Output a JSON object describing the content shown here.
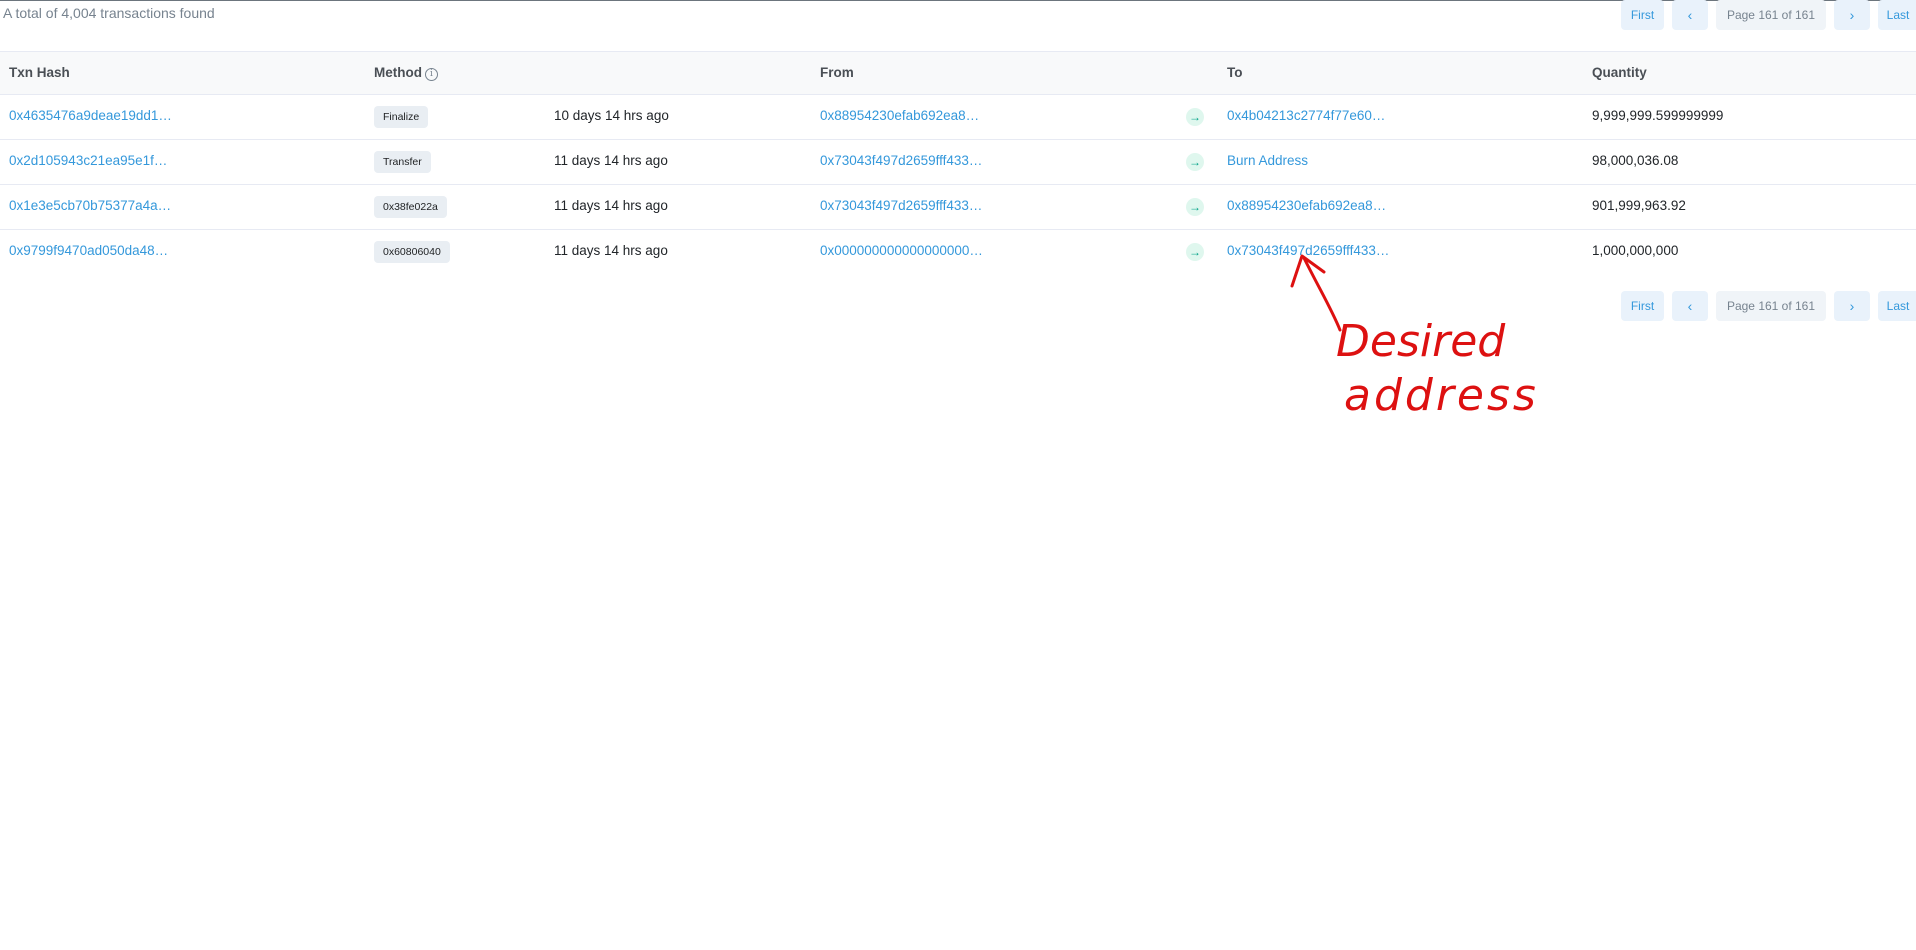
{
  "summary": "A total of 4,004 transactions found",
  "pagination": {
    "first": "First",
    "prev_icon": "‹",
    "page_label": "Page 161 of 161",
    "next_icon": "›",
    "last": "Last"
  },
  "table": {
    "headers": {
      "txn_hash": "Txn Hash",
      "method": "Method",
      "from": "From",
      "to": "To",
      "quantity": "Quantity"
    },
    "rows": [
      {
        "hash": "0x4635476a9deae19dd1…",
        "method": "Finalize",
        "age": "10 days 14 hrs ago",
        "from": "0x88954230efab692ea8…",
        "to": "0x4b04213c2774f77e60…",
        "quantity": "9,999,999.599999999"
      },
      {
        "hash": "0x2d105943c21ea95e1f…",
        "method": "Transfer",
        "age": "11 days 14 hrs ago",
        "from": "0x73043f497d2659fff433…",
        "to": "Burn Address",
        "quantity": "98,000,036.08"
      },
      {
        "hash": "0x1e3e5cb70b75377a4a…",
        "method": "0x38fe022a",
        "age": "11 days 14 hrs ago",
        "from": "0x73043f497d2659fff433…",
        "to": "0x88954230efab692ea8…",
        "quantity": "901,999,963.92"
      },
      {
        "hash": "0x9799f9470ad050da48…",
        "method": "0x60806040",
        "age": "11 days 14 hrs ago",
        "from": "0x000000000000000000…",
        "to": "0x73043f497d2659fff433…",
        "quantity": "1,000,000,000"
      }
    ]
  },
  "annotation": {
    "line1": "Desired",
    "line2": "address",
    "color": "#dd1111"
  }
}
